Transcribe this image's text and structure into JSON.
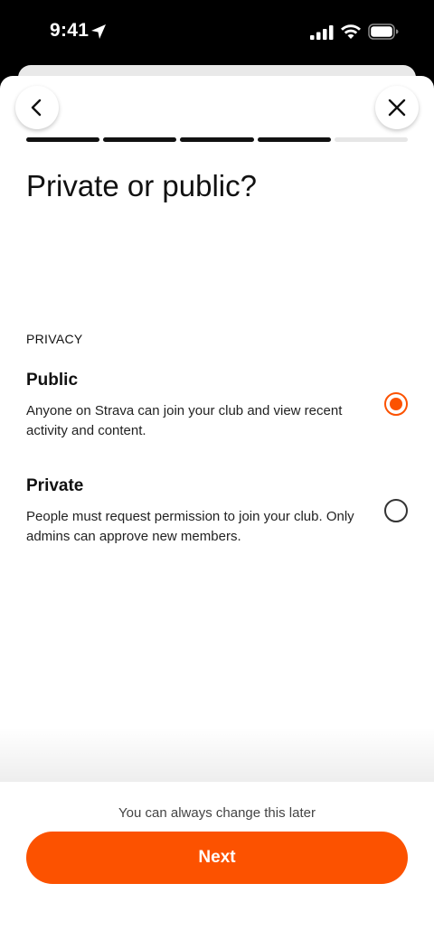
{
  "status_bar": {
    "time": "9:41"
  },
  "header": {
    "back_icon": "chevron-left-icon",
    "close_icon": "close-icon",
    "progress": {
      "total_steps": 5,
      "completed_steps": 4
    }
  },
  "main": {
    "title": "Private or public?",
    "section_label": "PRIVACY",
    "options": [
      {
        "title": "Public",
        "description": "Anyone on Strava can join your club and view recent activity and content.",
        "selected": true
      },
      {
        "title": "Private",
        "description": "People must request permission to join your club. Only admins can approve new members.",
        "selected": false
      }
    ]
  },
  "footer": {
    "note": "You can always change this later",
    "next_label": "Next"
  },
  "colors": {
    "accent": "#fc5200",
    "text": "#111111"
  }
}
